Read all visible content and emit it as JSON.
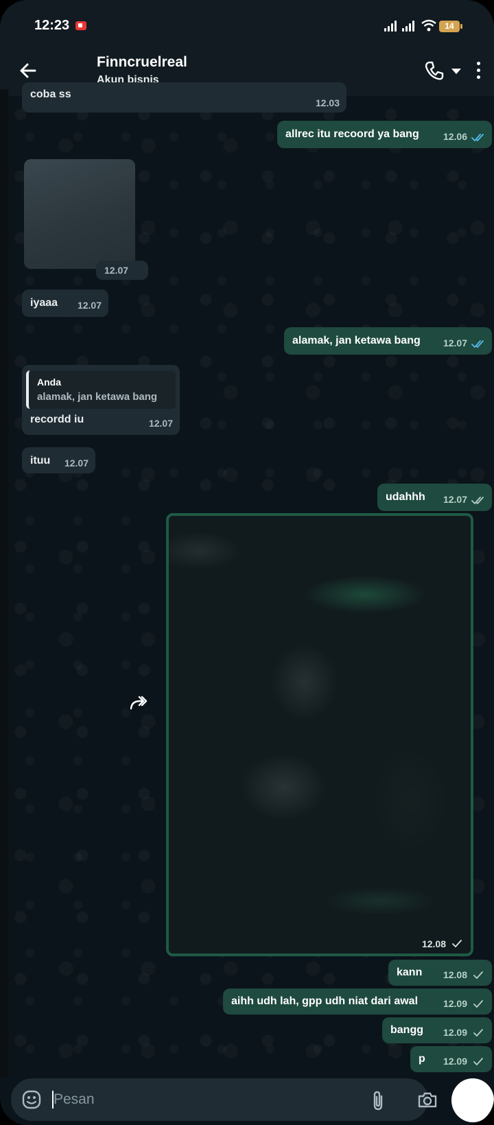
{
  "status_bar": {
    "time": "12:23",
    "battery": "14"
  },
  "header": {
    "title": "Finncruelreal",
    "subtitle": "Akun bisnis"
  },
  "messages": [
    {
      "dir": "in",
      "text": "coba ss",
      "time": "12.03"
    },
    {
      "dir": "out",
      "text": "allrec itu recoord ya bang",
      "time": "12.06",
      "status": "read"
    },
    {
      "dir": "in",
      "type": "image",
      "time": "12.07"
    },
    {
      "dir": "in",
      "text": "iyaaa",
      "time": "12.07"
    },
    {
      "dir": "out",
      "text": "alamak, jan ketawa bang",
      "time": "12.07",
      "status": "read"
    },
    {
      "dir": "in",
      "text": "recordd iu",
      "time": "12.07",
      "quote": {
        "author": "Anda",
        "text": "alamak, jan ketawa bang"
      }
    },
    {
      "dir": "in",
      "text": "ituu",
      "time": "12.07"
    },
    {
      "dir": "out",
      "text": "udahhh",
      "time": "12.07",
      "status": "delivered"
    },
    {
      "dir": "out",
      "type": "image",
      "time": "12.08",
      "status": "sent"
    },
    {
      "dir": "out",
      "text": "kann",
      "time": "12.08",
      "status": "sent"
    },
    {
      "dir": "out",
      "text": "aihh udh lah, gpp udh niat dari awal",
      "time": "12.09",
      "status": "sent"
    },
    {
      "dir": "out",
      "text": "bangg",
      "time": "12.09",
      "status": "sent"
    },
    {
      "dir": "out",
      "text": "p",
      "time": "12.09",
      "status": "sent"
    }
  ],
  "composer": {
    "placeholder": "Pesan"
  },
  "colors": {
    "read_tick": "#53bdeb",
    "outgoing_bubble": "#1f4a3f",
    "incoming_bubble": "#202c33",
    "background": "#0b141a"
  },
  "icons": [
    "back-arrow-icon",
    "phone-icon",
    "more-vert-icon",
    "forward-icon",
    "emoji-icon",
    "attach-icon",
    "camera-icon",
    "double-check-icon",
    "check-icon"
  ]
}
